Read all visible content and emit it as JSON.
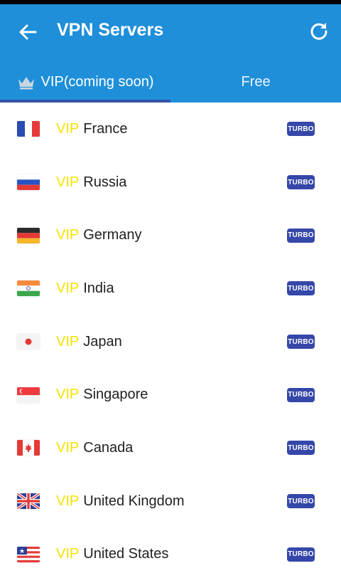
{
  "header": {
    "title": "VPN Servers",
    "back_icon": "arrow-left-icon",
    "refresh_icon": "refresh-icon"
  },
  "tabs": [
    {
      "label": "VIP(coming soon)",
      "icon": "crown-icon",
      "active": true
    },
    {
      "label": "Free",
      "active": false
    }
  ],
  "colors": {
    "appbar": "#1f8fda",
    "indicator": "#3453a8",
    "vip_text": "#f5e300",
    "turbo_badge": "#3547a8"
  },
  "servers": [
    {
      "prefix": "VIP",
      "country": "France",
      "badge": "TURBO",
      "flag": "france-flag-icon"
    },
    {
      "prefix": "VIP",
      "country": "Russia",
      "badge": "TURBO",
      "flag": "russia-flag-icon"
    },
    {
      "prefix": "VIP",
      "country": "Germany",
      "badge": "TURBO",
      "flag": "germany-flag-icon"
    },
    {
      "prefix": "VIP",
      "country": "India",
      "badge": "TURBO",
      "flag": "india-flag-icon"
    },
    {
      "prefix": "VIP",
      "country": "Japan",
      "badge": "TURBO",
      "flag": "japan-flag-icon"
    },
    {
      "prefix": "VIP",
      "country": "Singapore",
      "badge": "TURBO",
      "flag": "singapore-flag-icon"
    },
    {
      "prefix": "VIP",
      "country": "Canada",
      "badge": "TURBO",
      "flag": "canada-flag-icon"
    },
    {
      "prefix": "VIP",
      "country": "United Kingdom",
      "badge": "TURBO",
      "flag": "uk-flag-icon"
    },
    {
      "prefix": "VIP",
      "country": "United States",
      "badge": "TURBO",
      "flag": "us-flag-icon"
    }
  ]
}
